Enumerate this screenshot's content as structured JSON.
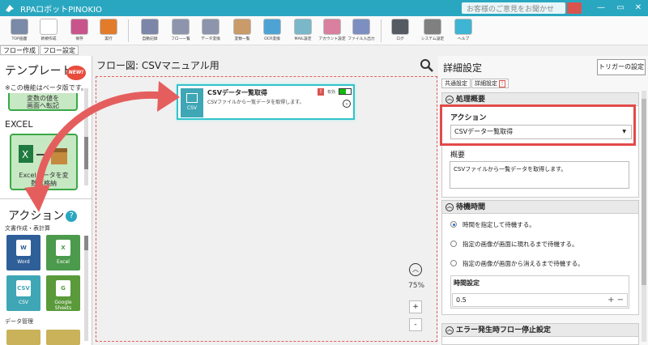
{
  "app": {
    "title": "RPAロボットPINOKIO",
    "feedback": "お客様のご意見をお聞かせください"
  },
  "window": {
    "minimize": "—",
    "restore": "▭",
    "close": "✕"
  },
  "toolbar": [
    {
      "label": "TOP画面",
      "color": "#7a8aa8"
    },
    {
      "label": "新規作成",
      "color": "#ffffff"
    },
    {
      "label": "保存",
      "color": "#c9548b"
    },
    {
      "label": "実行",
      "color": "#e27c2b"
    },
    {
      "label": "自動記録",
      "color": "#7b86a8"
    },
    {
      "label": "フロー一覧",
      "color": "#8d95ad"
    },
    {
      "label": "データ変換",
      "color": "#8d95ad"
    },
    {
      "label": "変数一覧",
      "color": "#c99a6a"
    },
    {
      "label": "OCR変換",
      "color": "#4fa3d4"
    },
    {
      "label": "MAIL設定",
      "color": "#7ab7c9"
    },
    {
      "label": "アカウント設定",
      "color": "#d97fa0"
    },
    {
      "label": "ファイル入出力",
      "color": "#7d8ec0"
    },
    {
      "label": "ログ",
      "color": "#555a63"
    },
    {
      "label": "システム設定",
      "color": "#808080"
    },
    {
      "label": "ヘルプ",
      "color": "#3fb5d4"
    }
  ],
  "tabs": {
    "flow_create": "フロー作成",
    "flow_settings": "フロー設定"
  },
  "left": {
    "template_title": "テンプレート",
    "new_badge": "NEW!",
    "beta_note": "※この機能はベータ版です。",
    "card_top": "変数の値を\n画面へ転記",
    "excel_section": "EXCEL",
    "excel_card": "Excelデータを変数へ格納",
    "action_title": "アクション",
    "help": "?",
    "cat_doc": "文書作成・表計算",
    "cat_data": "データ管理",
    "tiles": [
      {
        "label": "Word",
        "icon": "W",
        "color": "#2f5f98"
      },
      {
        "label": "Excel",
        "icon": "X",
        "color": "#4c9a4c"
      },
      {
        "label": "CSV",
        "icon": "CSV",
        "color": "#3fa6b5"
      },
      {
        "label": "Google Sheets",
        "icon": "G",
        "color": "#5a9a3a"
      }
    ]
  },
  "canvas": {
    "title": "フロー図:  CSVマニュアル用",
    "zoom": "75%",
    "node": {
      "icon_text": "CSV",
      "title": "CSVデータ一覧取得",
      "desc": "CSVファイルから一覧データを取得します。",
      "warn": "!",
      "valid": "有効"
    },
    "zoom_in": "+",
    "zoom_out": "-"
  },
  "right": {
    "title": "詳細設定",
    "trigger": "トリガーの設定",
    "tab_common": "共通設定",
    "tab_detail": "詳細設定",
    "tab_bang": "!",
    "sec_summary": "処理概要",
    "action_label": "アクション",
    "action_value": "CSVデータ一覧取得",
    "overview_label": "概要",
    "overview_value": "CSVファイルから一覧データを取得します。",
    "sec_wait": "待機時間",
    "radios": [
      {
        "label": "時間を指定して待機する。",
        "checked": true
      },
      {
        "label": "指定の画像が画面に現れるまで待機する。",
        "checked": false
      },
      {
        "label": "指定の画像が画面から消えるまで待機する。",
        "checked": false
      }
    ],
    "time_label": "時間設定",
    "time_value": "0.5",
    "time_pm": "+ −",
    "sec_error": "エラー発生時フロー停止設定"
  }
}
